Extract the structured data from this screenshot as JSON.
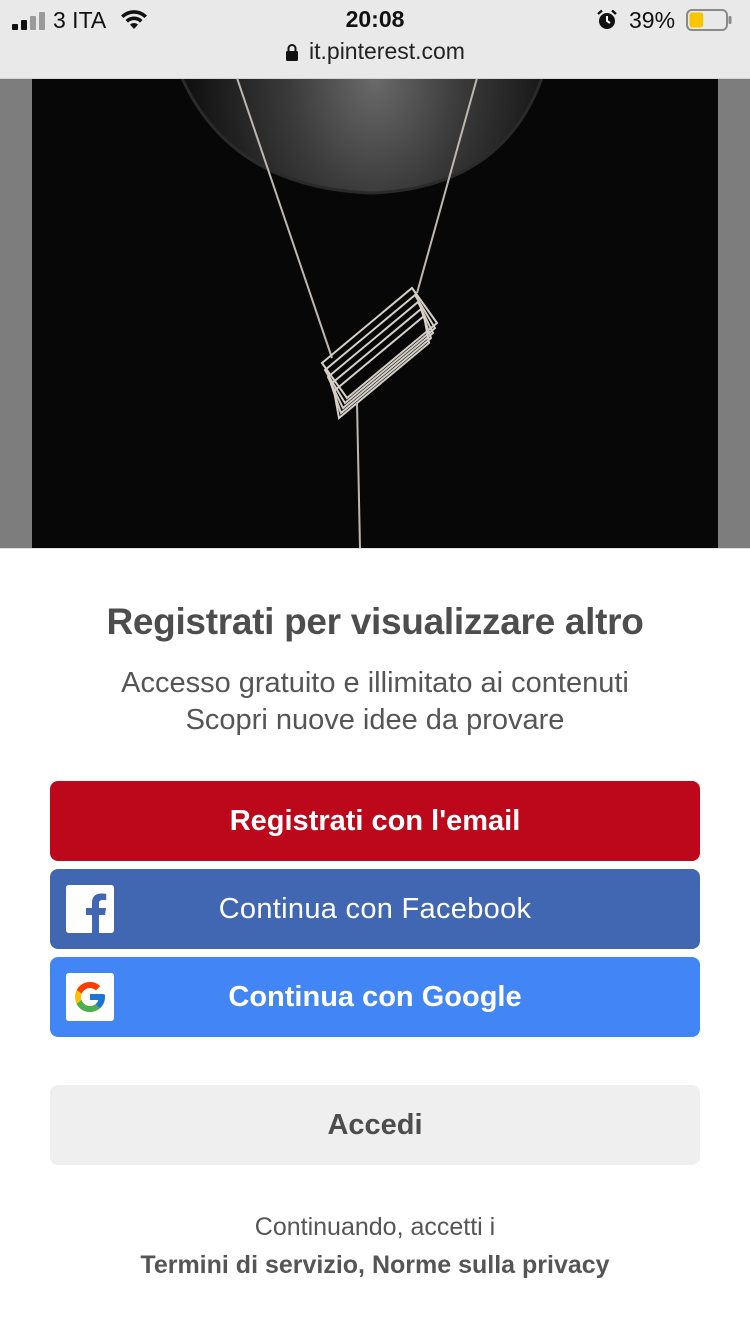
{
  "status_bar": {
    "carrier": "3 ITA",
    "time": "20:08",
    "battery_percent": "39%",
    "battery_level": 0.39,
    "battery_color": "#f7c600"
  },
  "url_bar": {
    "url": "it.pinterest.com"
  },
  "signup": {
    "title": "Registrati per visualizzare altro",
    "subtitle_line1": "Accesso gratuito e illimitato ai contenuti",
    "subtitle_line2": "Scopri nuove idee da provare",
    "email_button": "Registrati con l'email",
    "facebook_button": "Continua con Facebook",
    "google_button": "Continua con Google",
    "login_button": "Accedi",
    "legal_prefix": "Continuando, accetti i",
    "terms_link": "Termini di servizio,",
    "privacy_link": "Norme sulla privacy"
  },
  "colors": {
    "pinterest_red": "#bd081c",
    "facebook_blue": "#4267b2",
    "google_blue": "#4285f4",
    "login_gray": "#efefef"
  },
  "icons": [
    "signal-icon",
    "wifi-icon",
    "alarm-icon",
    "battery-icon",
    "lock-icon",
    "facebook-icon",
    "google-icon"
  ]
}
